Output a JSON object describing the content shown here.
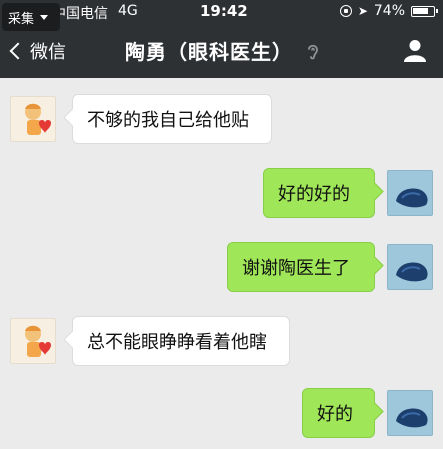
{
  "status_bar": {
    "carrier": "中国电信",
    "network": "4G",
    "time": "19:42",
    "battery": "74%"
  },
  "collect_badge": {
    "label": "采集"
  },
  "nav": {
    "back_label": "微信",
    "title": "陶勇（眼科医生）",
    "icons": [
      "back-chevron-icon",
      "ear-icon",
      "profile-icon"
    ]
  },
  "messages": [
    {
      "side": "left",
      "text": "不够的我自己给他贴"
    },
    {
      "side": "right",
      "text": "好的好的"
    },
    {
      "side": "right",
      "text": "谢谢陶医生了"
    },
    {
      "side": "left",
      "text": "总不能眼睁睁看着他瞎"
    },
    {
      "side": "right",
      "text": "好的"
    }
  ],
  "colors": {
    "topbar": "#2e3134",
    "chat_background": "#ebebeb",
    "outgoing_bubble": "#9fe658",
    "incoming_bubble": "#ffffff"
  }
}
